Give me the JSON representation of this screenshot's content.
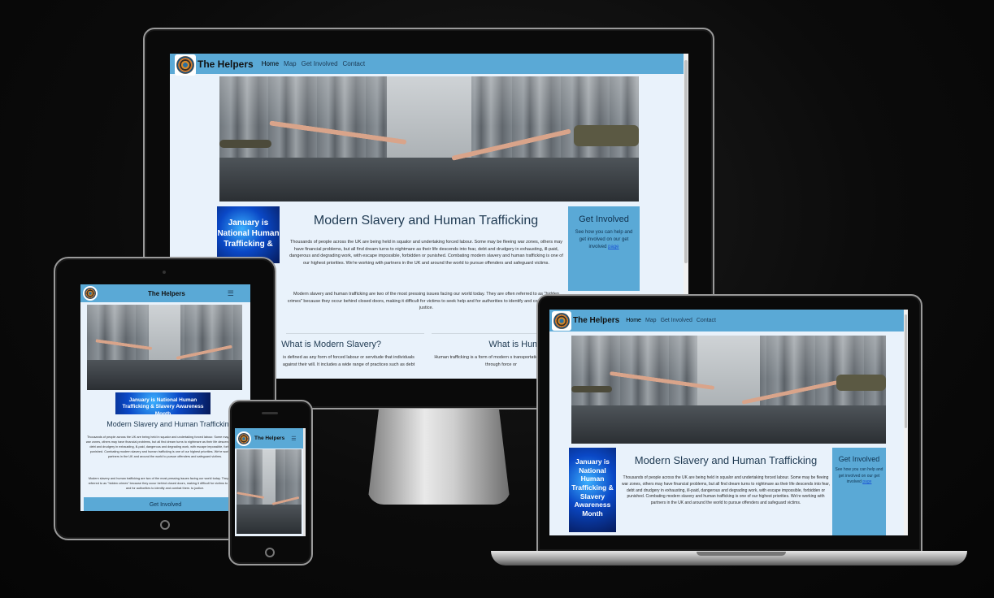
{
  "site": {
    "brand": "The Helpers",
    "nav": [
      "Home",
      "Map",
      "Get Involved",
      "Contact"
    ],
    "heading": "Modern Slavery and Human Trafficking",
    "badge_full": "January is National Human Trafficking & Slavery Awareness Month",
    "badge_desktop_visible": "January is National Human Trafficking &",
    "badge_tablet": "January is National Human Trafficking & Slavery Awareness Month",
    "intro_full": "Thousands of people across the UK are being held in squalor and undertaking forced labour. Some may be fleeing war zones, others may have financial problems, but all find dream turns to nightmare as their life descends into fear, debt and drudgery in exhausting, ill-paid, dangerous and degrading work, with escape impossible, forbidden or punished. Combating modern slavery and human trafficking is one of our highest priorities. We're working with partners in the UK and around the world to pursue offenders and safeguard victims.",
    "intro_short": "Thousands of people across the UK are being held in squalor and undertaking forced labour. Some may be fleeing war zones, others may have financial problems, but all find dream turns to nightmare as their life descends into fear, debt and drudgery in exhausting, ill-paid, dangerous and degrading work, with escape impossible, forbidden or punished. Combating modern slavery and human trafficking is one of our highest priorities. We're working with partners in the UK and around the world to pursue offenders and safeguard victims.",
    "second_para": "Modern slavery and human trafficking are two of the most pressing issues facing our world today. They are often referred to as \"hidden crimes\" because they occur behind closed doors, making it difficult for victims to seek help and for authorities to identify and combat them. to justice.",
    "get_involved_title": "Get Involved",
    "get_involved_text": "See how you can help and get involved on our get involved",
    "get_involved_link": "page",
    "section1_title": "What is Modern Slavery?",
    "section1_text": "is defined as any form of forced labour or servitude that individuals against their will. It includes a wide range of practices such as debt",
    "section2_title": "What is Human",
    "section2_text": "Human trafficking is a form of modern s transportation of individuals through force or"
  }
}
